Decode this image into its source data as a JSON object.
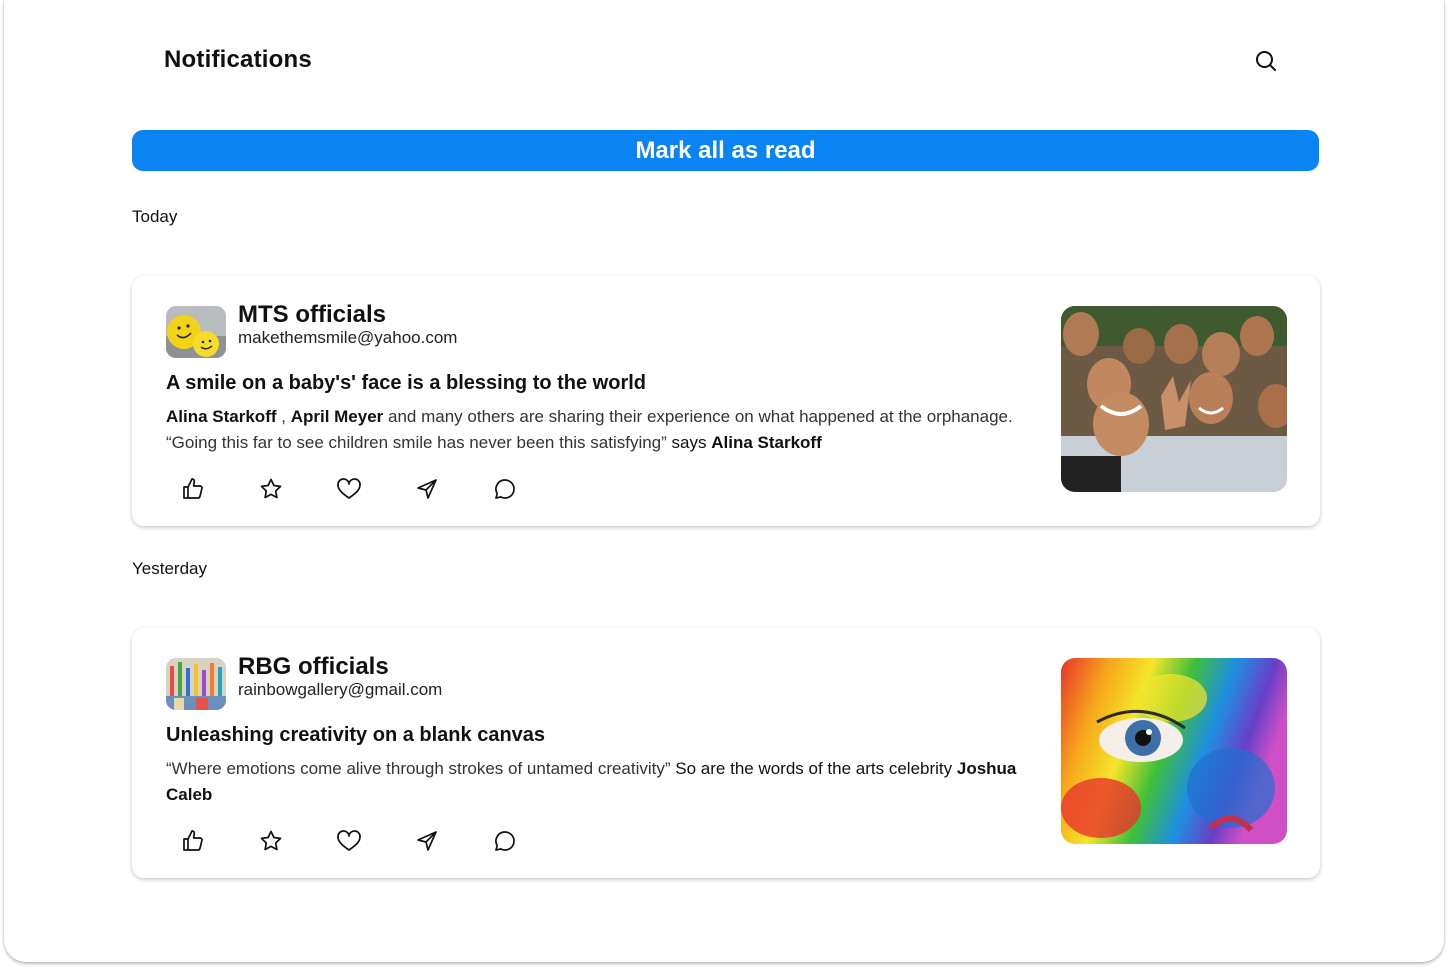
{
  "header": {
    "title": "Notifications",
    "search_icon": "search-icon"
  },
  "mark_all_label": "Mark all as read",
  "accent_color": "#0b84f3",
  "sections": [
    {
      "label": "Today",
      "card": {
        "sender_name": "MTS officials",
        "sender_email": "makethemsmile@yahoo.com",
        "headline": "A smile on a baby's' face is a blessing to the world",
        "line1": {
          "name1": "Alina Starkoff",
          "sep": " , ",
          "name2": "April Meyer",
          "rest": " and many others are sharing their experience on what happened at the orphanage."
        },
        "line2": {
          "quote": "“Going this far to see children smile has never been this satisfying” ",
          "says": "says ",
          "name": "Alina Starkoff"
        },
        "avatar_icon": "smiley-balls-avatar",
        "image_icon": "smiling-children-photo"
      }
    },
    {
      "label": "Yesterday",
      "card": {
        "sender_name": "RBG officials",
        "sender_email": "rainbowgallery@gmail.com",
        "headline": "Unleashing creativity on a  blank canvas",
        "body": {
          "quote": "“Where emotions come alive through strokes of untamed creativity” ",
          "rest": "So are the words of the arts celebrity ",
          "name": "Joshua Caleb"
        },
        "avatar_icon": "paintbrushes-avatar",
        "image_icon": "rainbow-painted-face-photo"
      }
    }
  ],
  "actions": [
    "like-icon",
    "star-icon",
    "heart-icon",
    "share-icon",
    "comment-icon"
  ]
}
